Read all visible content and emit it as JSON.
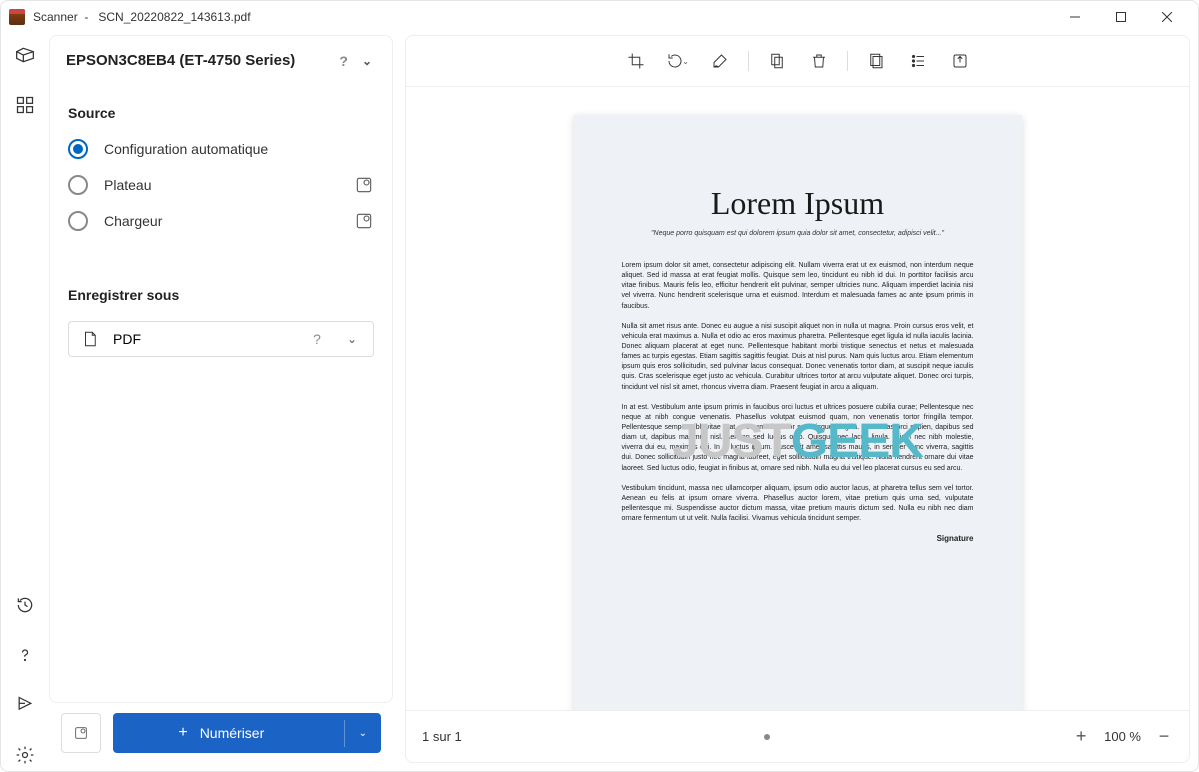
{
  "title": {
    "app": "Scanner",
    "sep": "-",
    "file": "SCN_20220822_143613.pdf"
  },
  "device": {
    "name": "EPSON3C8EB4 (ET-4750 Series)",
    "help": "?"
  },
  "source": {
    "label": "Source",
    "options": {
      "auto": "Configuration automatique",
      "flatbed": "Plateau",
      "feeder": "Chargeur"
    }
  },
  "save": {
    "label": "Enregistrer sous",
    "format": "PDF",
    "help": "?"
  },
  "scan": {
    "label": "Numériser"
  },
  "pager": {
    "text": "1 sur 1"
  },
  "zoom": {
    "label": "100 %"
  },
  "doc": {
    "title": "Lorem Ipsum",
    "quote": "\"Neque porro quisquam est qui dolorem ipsum quia dolor sit amet, consectetur, adipisci velit...\"",
    "p1": "Lorem ipsum dolor sit amet, consectetur adipiscing elit. Nullam viverra erat ut ex euismod, non interdum neque aliquet. Sed id massa at erat feugiat mollis. Quisque sem leo, tincidunt eu nibh id dui. In porttitor facilisis arcu vitae finibus. Mauris felis leo, efficitur hendrerit elit pulvinar, semper ultricies nunc. Aliquam imperdiet lacinia nisi vel viverra. Nunc hendrerit scelerisque urna et euismod. Interdum et malesuada fames ac ante ipsum primis in faucibus.",
    "p2": "Nulla sit amet risus ante. Donec eu augue a nisi suscipit aliquet non in nulla ut magna. Proin cursus eros velit, et vehicula erat maximus a. Nulla et odio ac eros maximus pharetra. Pellentesque eget ligula id nulla iaculis lacinia. Donec aliquam placerat at eget nunc. Pellentesque habitant morbi tristique senectus et netus et malesuada fames ac turpis egestas. Etiam sagittis sagittis feugiat. Duis at nisl purus. Nam quis luctus arcu. Etiam elementum ipsum quis eros sollicitudin, sed pulvinar lacus consequat. Donec venenatis tortor diam, at suscipit neque iaculis quis. Cras scelerisque eget justo ac vehicula. Curabitur ultrices tortor at arcu vulputate aliquet. Donec orci turpis, tincidunt vel nisl sit amet, rhoncus viverra diam. Praesent feugiat in arcu a aliquam.",
    "p3": "In at est. Vestibulum ante ipsum primis in faucibus orci luctus et ultrices posuere cubilia curae; Pellentesque nec neque at nibh congue venenatis. Phasellus volutpat euismod quam, non venenatis tortor fringilla tempor. Pellentesque semper nibh vitae erat, a commodo dolor scelerisque fringilla. Maecenas orci sapien, dapibus sed diam ut, dapibus maximus nisl. Aenean sed luctus odio. Quisque nec lacus ligula. Etiam nec nibh molestie, viverra dui eu, maximus dui. In id luctus ipsum. Fusce sit amet sagittis mauris, in semper nunc viverra, sagittis dui. Donec sollicitudin justo nec magna laoreet, eget sollicitudin magna tristique. Nulla hendrerit ornare dui vitae laoreet. Sed luctus odio, feugiat in finibus at, ornare sed nibh. Nulla eu dui vel leo placerat cursus eu sed arcu.",
    "p4": "Vestibulum tincidunt, massa nec ullamcorper aliquam, ipsum odio auctor lacus, at pharetra tellus sem vel tortor. Aenean eu felis at ipsum ornare viverra. Phasellus auctor lorem, vitae pretium quis urna sed, vulputate pellentesque mi. Suspendisse auctor dictum massa, vitae pretium mauris dictum sed. Nulla eu nibh nec diam ornare fermentum ut ut velit. Nulla facilisi. Vivamus vehicula tincidunt semper.",
    "signature": "Signature"
  },
  "watermark": {
    "part1": "JUST",
    "part2": "GEEK"
  }
}
